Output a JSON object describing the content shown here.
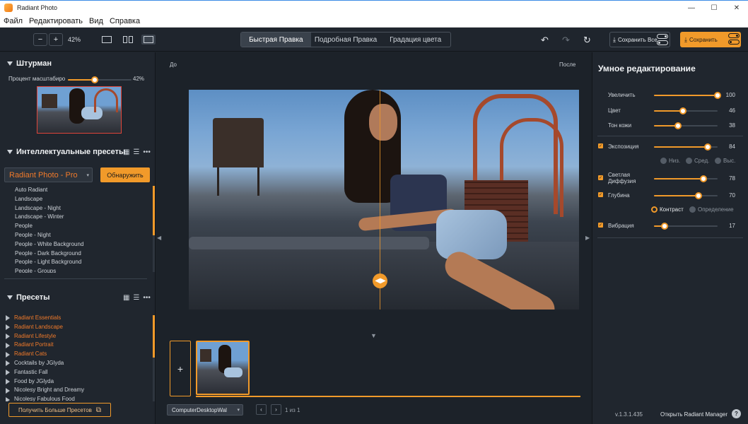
{
  "window": {
    "title": "Radiant Photo",
    "controls": [
      "—",
      "☐",
      "✕"
    ]
  },
  "menu": [
    "Файл",
    "Редактировать",
    "Вид",
    "Справка"
  ],
  "toolbar": {
    "zoom_out": "−",
    "zoom_in": "+",
    "zoom_level": "42%",
    "tabs": [
      {
        "label": "Быстрая Правка",
        "active": true
      },
      {
        "label": "Подробная Правка",
        "active": false
      },
      {
        "label": "Градация цвета",
        "active": false
      }
    ],
    "undo": "↶",
    "redo": "↷",
    "reset": "↻",
    "save_all": "Сохранить Все",
    "save": "Сохранить"
  },
  "navigator": {
    "title": "Штурман",
    "zoom_label": "Процент масштабирования",
    "zoom_value": "42%",
    "zoom_fraction": 0.42
  },
  "smart_presets": {
    "title": "Интеллектуальные пресеты",
    "selected": "Radiant Photo - Pro",
    "discover_button": "Обнаружить",
    "items": [
      "Auto Radiant",
      "Landscape",
      "Landscape - Night",
      "Landscape - Winter",
      "People",
      "People - Night",
      "People - White Background",
      "People - Dark Background",
      "People - Light Background",
      "People - Groups"
    ]
  },
  "presets": {
    "title": "Пресеты",
    "items": [
      {
        "label": "Radiant Essentials",
        "highlight": true
      },
      {
        "label": "Radiant Landscape",
        "highlight": true
      },
      {
        "label": "Radiant Lifestyle",
        "highlight": true
      },
      {
        "label": "Radiant Portrait",
        "highlight": true
      },
      {
        "label": "Radiant Cats",
        "highlight": true
      },
      {
        "label": "Cocktails by JGlyda",
        "highlight": false
      },
      {
        "label": "Fantastic Fall",
        "highlight": false
      },
      {
        "label": "Food by JGlyda",
        "highlight": false
      },
      {
        "label": "Nicolesy Bright and Dreamy",
        "highlight": false
      },
      {
        "label": "Nicolesy Fabulous Food",
        "highlight": false
      }
    ],
    "more_button": "Получить Больше Пресетов"
  },
  "canvas": {
    "before_label": "До",
    "after_label": "После",
    "split_fraction": 0.49
  },
  "filmstrip": {
    "add_label": "+",
    "folder": "ComputerDesktopWal",
    "page_text": "1 из 1"
  },
  "smart_edit": {
    "title": "Умное редактирование",
    "sliders": [
      {
        "label": "Увеличить",
        "value": 100,
        "checkbox": false
      },
      {
        "label": "Цвет",
        "value": 46,
        "checkbox": false
      },
      {
        "label": "Тон кожи",
        "value": 38,
        "checkbox": false
      },
      {
        "label": "Экспозиция",
        "value": 84,
        "checkbox": true
      },
      {
        "label": "Светлая Диффузия",
        "value": 78,
        "checkbox": true
      },
      {
        "label": "Глубина",
        "value": 70,
        "checkbox": true
      },
      {
        "label": "Вибрация",
        "value": 17,
        "checkbox": true
      }
    ],
    "exposure_modes": [
      {
        "label": "Низ.",
        "active": false
      },
      {
        "label": "Сред.",
        "active": false
      },
      {
        "label": "Выс.",
        "active": false
      }
    ],
    "depth_modes": [
      {
        "label": "Контраст",
        "active": true
      },
      {
        "label": "Определение",
        "active": false
      }
    ]
  },
  "footer": {
    "version": "v.1.3.1.435",
    "manager_link": "Открыть Radiant Manager",
    "help": "?"
  },
  "colors": {
    "accent": "#f19a2a",
    "preset_highlight": "#f07a2a",
    "panel_bg": "#20262e"
  }
}
